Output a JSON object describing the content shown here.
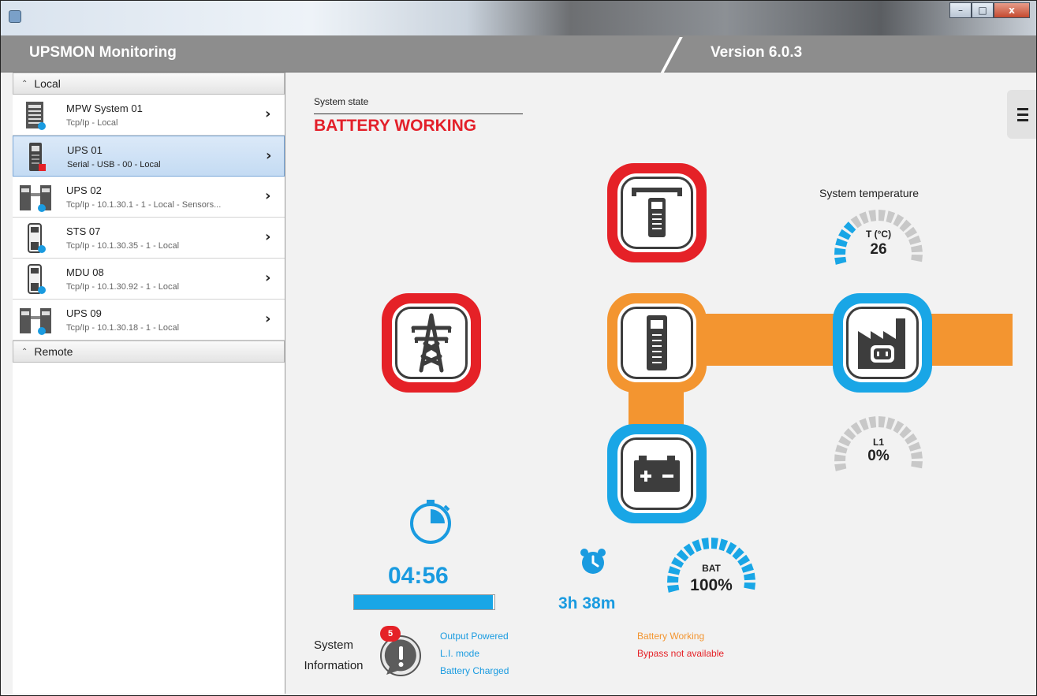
{
  "window": {
    "buttons": {
      "minimize": "–",
      "maximize": "□",
      "close": "x"
    }
  },
  "header": {
    "title": "UPSMON Monitoring",
    "version": "Version 6.0.3"
  },
  "sidebar": {
    "local_label": "Local",
    "remote_label": "Remote",
    "devices": [
      {
        "name": "MPW System 01",
        "detail": "Tcp/Ip - Local",
        "icon": "rack-ups-icon",
        "status_color": "#1a9be0"
      },
      {
        "name": "UPS 01",
        "detail": "Serial - USB - 00 - Local",
        "icon": "tower-ups-icon",
        "status_color": "#e52127"
      },
      {
        "name": "UPS 02",
        "detail": "Tcp/Ip - 10.1.30.1 - 1 - Local - Sensors...",
        "icon": "dual-ups-icon",
        "status_color": "#1a9be0"
      },
      {
        "name": "STS 07",
        "detail": "Tcp/Ip - 10.1.30.35 - 1 - Local",
        "icon": "sts-icon",
        "status_color": "#1a9be0"
      },
      {
        "name": "MDU 08",
        "detail": "Tcp/Ip - 10.1.30.92 - 1 - Local",
        "icon": "mdu-icon",
        "status_color": "#1a9be0"
      },
      {
        "name": "UPS 09",
        "detail": "Tcp/Ip - 10.1.30.18 - 1 - Local",
        "icon": "dual-ups-icon",
        "status_color": "#1a9be0"
      }
    ]
  },
  "main": {
    "state_label": "System state",
    "state_value": "BATTERY WORKING",
    "temperature": {
      "title": "System temperature",
      "unit_label": "T (°C)",
      "value": "26",
      "fraction": 0.3
    },
    "load": {
      "label": "L1",
      "value": "0%",
      "fraction": 0.0
    },
    "battery": {
      "label": "BAT",
      "value": "100%",
      "fraction": 1.0
    },
    "backup_timer": "04:56",
    "backup_progress": 0.99,
    "autonomy": "3h 38m",
    "system_info": {
      "title_line1": "System",
      "title_line2": "Information",
      "badge_count": "5",
      "messages_left": [
        "Output Powered",
        "L.I. mode",
        "Battery Charged"
      ],
      "messages_right": [
        "Battery Working",
        "Bypass not available"
      ]
    }
  },
  "colors": {
    "alarm_red": "#e52127",
    "flow_orange": "#f39530",
    "ok_blue": "#19a6e6",
    "header_gray": "#8d8d8d"
  }
}
